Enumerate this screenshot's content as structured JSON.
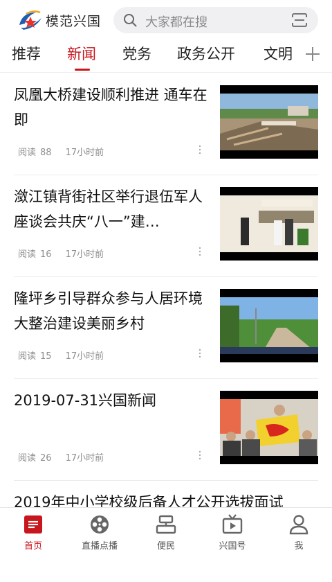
{
  "header": {
    "logo_text": "模范兴国",
    "search_placeholder": "大家都在搜"
  },
  "tabs": [
    {
      "label": "推荐",
      "active": false
    },
    {
      "label": "新闻",
      "active": true
    },
    {
      "label": "党务",
      "active": false
    },
    {
      "label": "政务公开",
      "active": false
    },
    {
      "label": "文明",
      "active": false
    }
  ],
  "news": [
    {
      "title": "凤凰大桥建设顺利推进 通车在即",
      "reads_label": "阅读",
      "reads": "88",
      "time": "17小时前"
    },
    {
      "title": "潋江镇背街社区举行退伍军人座谈会共庆“八一”建…",
      "reads_label": "阅读",
      "reads": "16",
      "time": "17小时前"
    },
    {
      "title": "隆坪乡引导群众参与人居环境大整治建设美丽乡村",
      "reads_label": "阅读",
      "reads": "15",
      "time": "17小时前"
    },
    {
      "title": "2019-07-31兴国新闻",
      "reads_label": "阅读",
      "reads": "26",
      "time": "17小时前"
    },
    {
      "title": "2019年中小学校级后备人才公开选拔面试"
    }
  ],
  "bottom_nav": [
    {
      "label": "首页",
      "icon": "home-icon",
      "active": true
    },
    {
      "label": "直播点播",
      "icon": "film-reel-icon",
      "active": false
    },
    {
      "label": "便民",
      "icon": "service-icon",
      "active": false
    },
    {
      "label": "兴国号",
      "icon": "tv-icon",
      "active": false
    },
    {
      "label": "我",
      "icon": "user-icon",
      "active": false
    }
  ],
  "colors": {
    "accent": "#c8161d"
  }
}
